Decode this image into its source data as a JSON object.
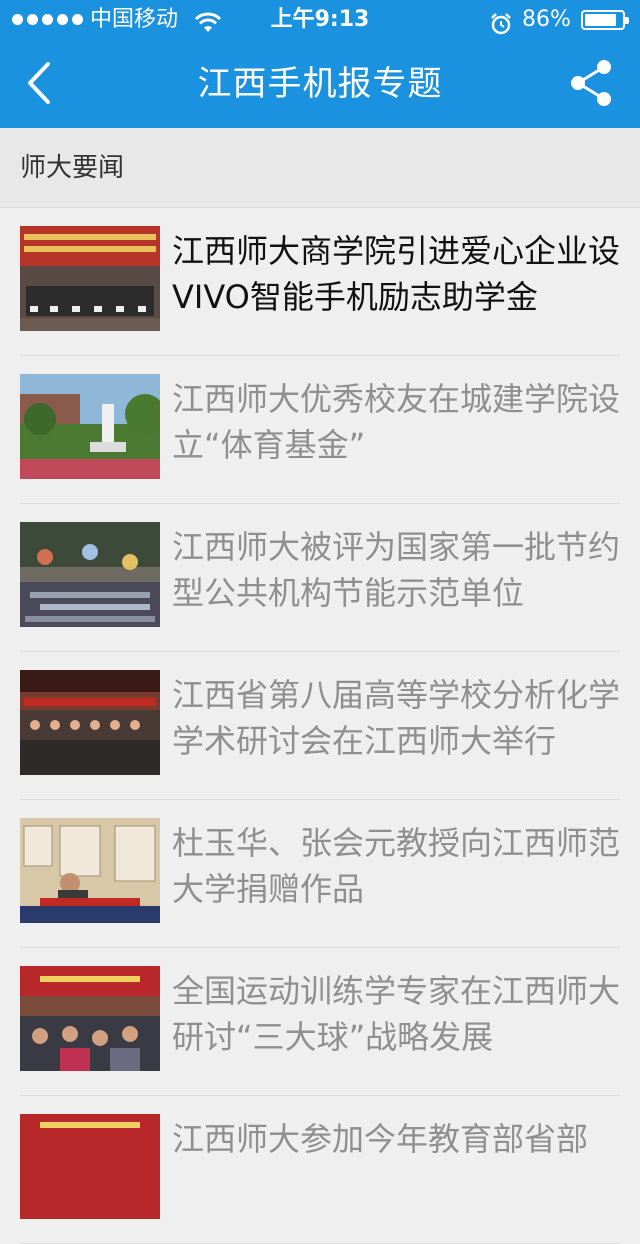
{
  "status_bar": {
    "carrier": "中国移动",
    "time": "上午9:13",
    "battery": "86%",
    "battery_level": 0.86
  },
  "nav": {
    "title": "江西手机报专题"
  },
  "section": {
    "title": "师大要闻"
  },
  "articles": [
    {
      "title": "江西师大商学院引进爱心企业设VIVO智能手机励志助学金"
    },
    {
      "title": "江西师大优秀校友在城建学院设立“体育基金”"
    },
    {
      "title": "江西师大被评为国家第一批节约型公共机构节能示范单位"
    },
    {
      "title": "江西省第八届高等学校分析化学学术研讨会在江西师大举行"
    },
    {
      "title": "杜玉华、张会元教授向江西师范大学捐赠作品"
    },
    {
      "title": "全国运动训练学专家在江西师大研讨“三大球”战略发展"
    },
    {
      "title": "江西师大参加今年教育部省部"
    }
  ],
  "colors": {
    "accent": "#1a92e0",
    "read_title": "#8f8f8f",
    "unread_title": "#111111"
  }
}
